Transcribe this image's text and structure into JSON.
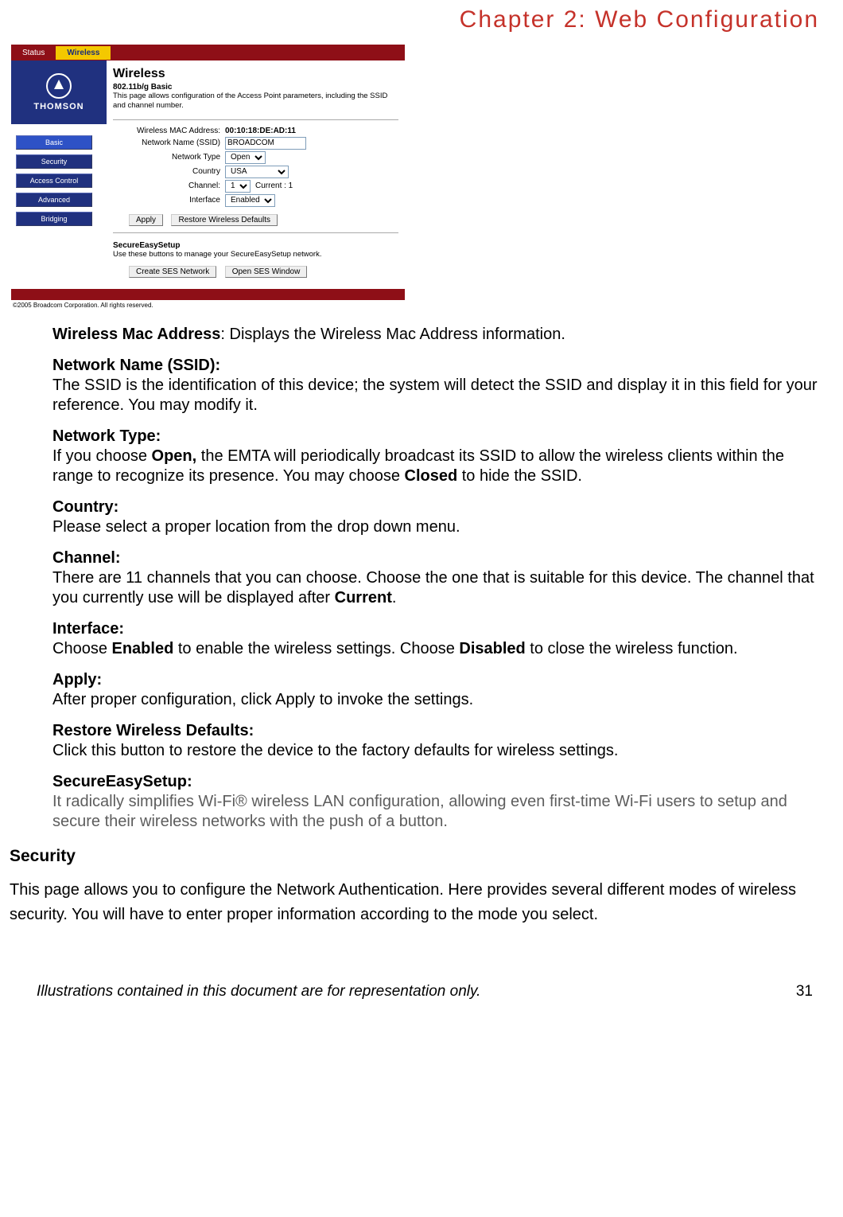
{
  "chapter_title": "Chapter 2: Web Configuration",
  "figure": {
    "topbar": {
      "status": "Status",
      "wireless": "Wireless"
    },
    "logo_text": "THOMSON",
    "sidebar": [
      "Basic",
      "Security",
      "Access Control",
      "Advanced",
      "Bridging"
    ],
    "content": {
      "title": "Wireless",
      "subtitle": "802.11b/g Basic",
      "description": "This page allows configuration of the Access Point parameters, including the SSID and channel number.",
      "mac_label": "Wireless MAC Address:",
      "mac_value": "00:10:18:DE:AD:11",
      "ssid_label": "Network Name (SSID)",
      "ssid_value": "BROADCOM",
      "nettype_label": "Network Type",
      "nettype_value": "Open",
      "country_label": "Country",
      "country_value": "USA",
      "channel_label": "Channel:",
      "channel_value": "1",
      "channel_after": "Current : 1",
      "interface_label": "Interface",
      "interface_value": "Enabled",
      "apply_btn": "Apply",
      "restore_btn": "Restore Wireless Defaults",
      "ses_head": "SecureEasySetup",
      "ses_desc": "Use these buttons to manage your SecureEasySetup network.",
      "ses_create_btn": "Create SES Network",
      "ses_open_btn": "Open SES Window"
    },
    "copyright": "©2005 Broadcom Corporation. All rights reserved."
  },
  "items": {
    "mac": {
      "lead": "Wireless Mac Address",
      "rest": ": Displays the Wireless Mac Address information."
    },
    "ssid": {
      "lead": "Network Name (SSID):",
      "rest": "The SSID is the identification of this device; the system will detect the SSID and display it in this field for your reference. You may modify it."
    },
    "nettype": {
      "lead": "Network Type:",
      "p1": "If you choose ",
      "b1": "Open,",
      "p2": " the EMTA will periodically broadcast its SSID to allow the wireless clients within the range to recognize its presence. You may choose ",
      "b2": "Closed",
      "p3": " to hide the SSID."
    },
    "country": {
      "lead": "Country:",
      "rest": "Please select a proper location from the drop down menu."
    },
    "channel": {
      "lead": "Channel:",
      "p1": "There are 11 channels that you can choose. Choose the one that is suitable for this device. The channel that you currently use will be displayed after ",
      "b1": "Current",
      "p2": "."
    },
    "interface": {
      "lead": "Interface:",
      "p1": "Choose ",
      "b1": "Enabled",
      "p2": " to enable the wireless settings. Choose ",
      "b2": "Disabled",
      "p3": " to close the wireless function."
    },
    "apply": {
      "lead": "Apply:",
      "rest": "After proper configuration, click Apply to invoke the settings."
    },
    "restore": {
      "lead": "Restore Wireless Defaults:",
      "rest": "Click this button to restore the device to the factory defaults for wireless settings."
    },
    "ses": {
      "lead": "SecureEasySetup:",
      "rest": "It radically simplifies Wi-Fi® wireless LAN configuration, allowing even first-time Wi-Fi users to setup and secure their wireless networks with the push of a button."
    }
  },
  "security": {
    "head": "Security",
    "para": "This page allows you to configure the Network Authentication. Here provides several different modes of wireless security. You will have to enter proper information according to the mode you select."
  },
  "footer": {
    "note": "Illustrations contained in this document are for representation only.",
    "page": "31"
  }
}
